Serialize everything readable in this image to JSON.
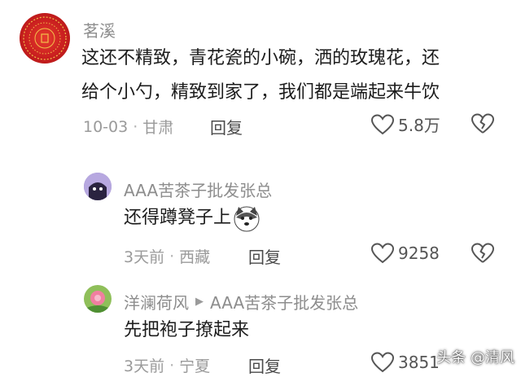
{
  "comments": [
    {
      "username": "茗溪",
      "lines": [
        "这还不精致，青花瓷的小碗，洒的玫瑰花，还",
        "给个小勺，精致到家了，我们都是端起来牛饮"
      ],
      "date": "10-03",
      "location": "甘肃",
      "reply_label": "回复",
      "likes": "5.8万"
    },
    {
      "username": "AAA苦茶子批发张总",
      "text": "还得蹲凳子上",
      "date": "3天前",
      "location": "西藏",
      "reply_label": "回复",
      "likes": "9258"
    },
    {
      "username": "洋澜荷风",
      "reply_to": "AAA苦茶子批发张总",
      "text": "先把袍子撩起来",
      "date": "3天前",
      "location": "宁夏",
      "reply_label": "回复",
      "likes": "3851"
    }
  ],
  "watermark": "头条 @清风",
  "colors": {
    "avatar1": "#c91f1f",
    "text_primary": "#1c1c1c",
    "text_secondary": "#8d8d8d"
  }
}
